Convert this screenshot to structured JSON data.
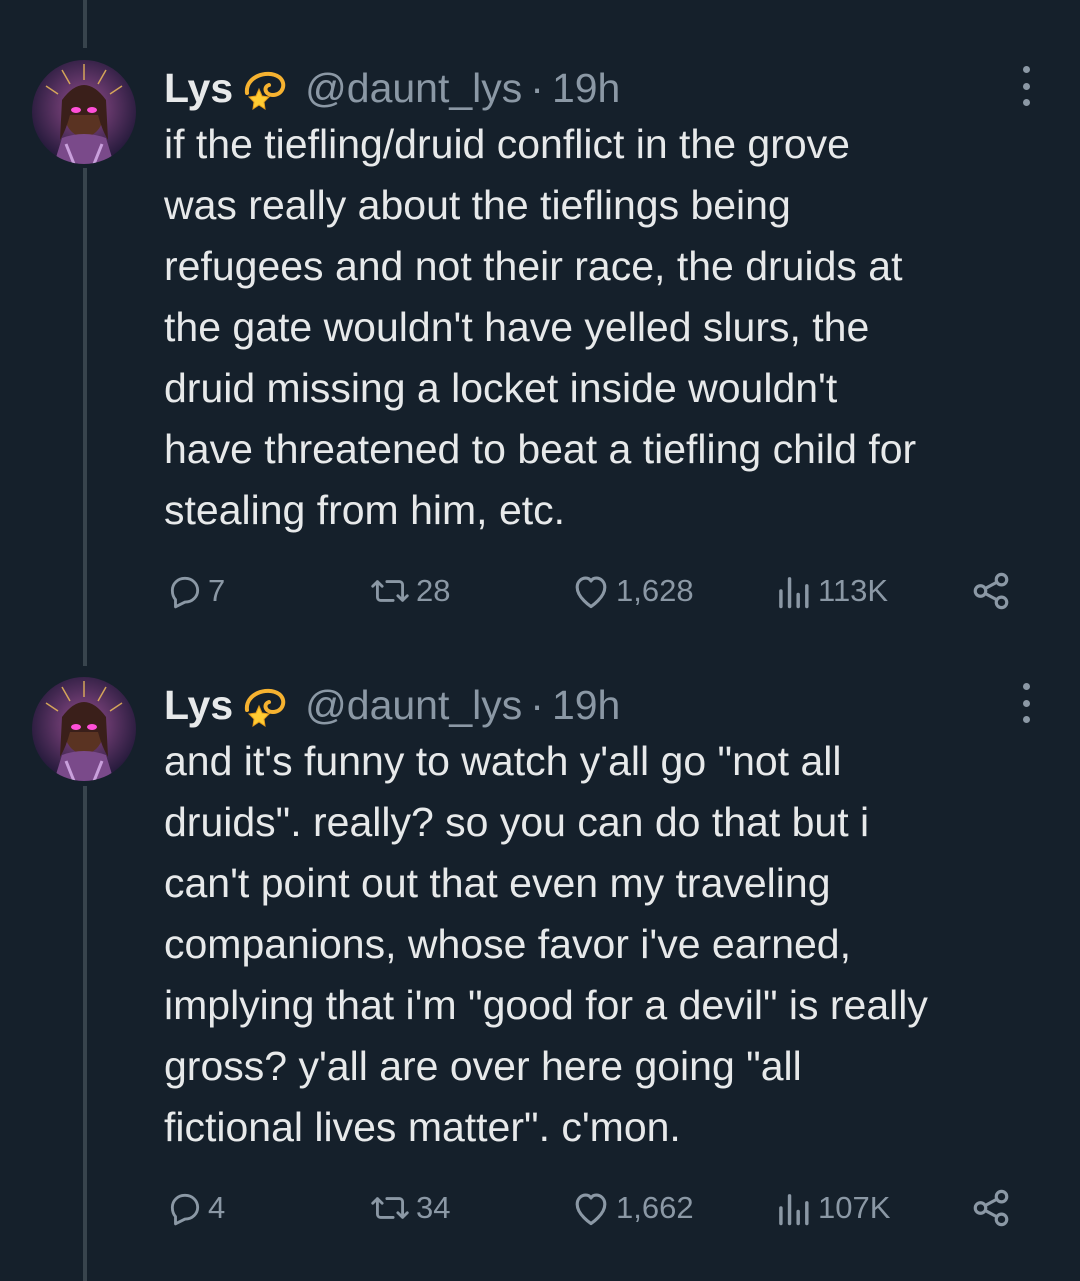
{
  "tweets": [
    {
      "author": {
        "name": "Lys",
        "handle": "@daunt_lys",
        "badge_icon": "dizzy-emoji-icon"
      },
      "separator": "·",
      "time": "19h",
      "text_lines": [
        "if the tiefling/druid conflict in the grove",
        "was really about the tieflings being",
        "refugees and not their race, the druids at",
        "the gate wouldn't have yelled slurs, the",
        "druid missing a locket inside wouldn't",
        "have threatened to beat a tiefling child for",
        "stealing from him, etc."
      ],
      "stats": {
        "replies": "7",
        "retweets": "28",
        "likes": "1,628",
        "views": "113K"
      }
    },
    {
      "author": {
        "name": "Lys",
        "handle": "@daunt_lys",
        "badge_icon": "dizzy-emoji-icon"
      },
      "separator": "·",
      "time": "19h",
      "text_lines": [
        "and it's funny to watch y'all go \"not all",
        "druids\". really? so you can do that but i",
        "can't point out that even my traveling",
        "companions, whose favor i've earned,",
        "implying that i'm \"good for a devil\" is really",
        "gross? y'all are over here going \"all",
        "fictional lives matter\". c'mon."
      ],
      "stats": {
        "replies": "4",
        "retweets": "34",
        "likes": "1,662",
        "views": "107K"
      }
    }
  ],
  "colors": {
    "background": "#15202b",
    "text": "#e7e9ea",
    "muted": "#8b98a5",
    "thread_line": "#38444d"
  }
}
